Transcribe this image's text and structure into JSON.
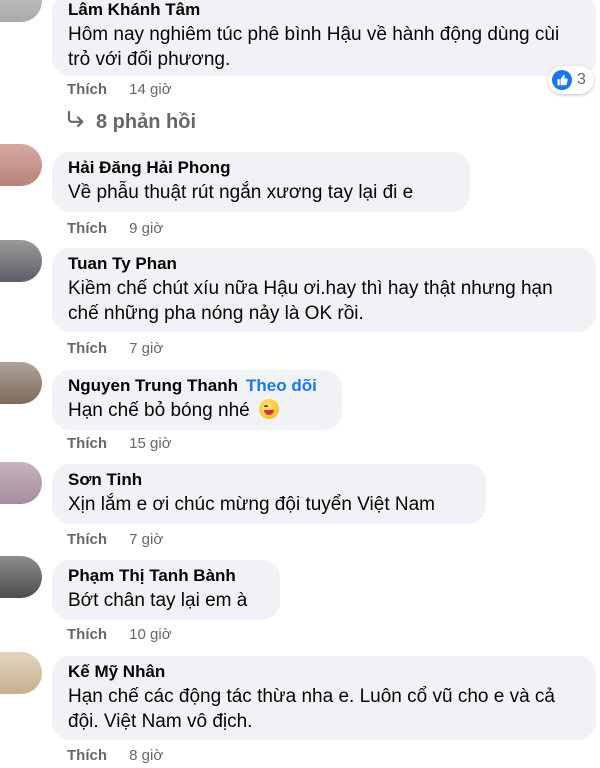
{
  "colors": {
    "bubble": "#f0f2f5",
    "link": "#1877f2",
    "muted": "#65676b",
    "text": "#050505"
  },
  "like_label": "Thích",
  "comments": [
    {
      "author": "Lâm Khánh Tâm",
      "text": "Hôm nay nghiêm túc phê bình Hậu về hành động dùng cùi trỏ với đối phương.",
      "time": "14 giờ",
      "reaction_icon": "like-icon",
      "reaction_count": "3"
    },
    {
      "author": "Hải Đăng Hải Phong",
      "text": "Về phẫu thuật rút ngắn xương tay lại đi e",
      "time": "9 giờ"
    },
    {
      "author": "Tuan Ty Phan",
      "text": "Kiềm chế chút xíu nữa Hậu ơi.hay thì hay thật nhưng hạn chế những pha nóng nảy là OK rồi.",
      "time": "7 giờ"
    },
    {
      "author": "Nguyen Trung Thanh",
      "follow": "Theo dõi",
      "text": "Hạn chế bỏ bóng nhé",
      "emoji": "winking-tongue-emoji",
      "time": "15 giờ"
    },
    {
      "author": "Sơn Tinh",
      "text": "Xịn lắm e ơi chúc mừng đội tuyển Việt Nam",
      "time": "7 giờ"
    },
    {
      "author": "Phạm Thị Tanh Bành",
      "text": "Bớt chân tay lại em à",
      "time": "10 giờ"
    },
    {
      "author": "Kế Mỹ Nhân",
      "text": "Hạn chế các động tác thừa nha e. Luôn cổ vũ cho e và cả đội. Việt Nam vô địch.",
      "time": "8 giờ"
    }
  ],
  "replies_link": {
    "icon": "reply-arrow-icon",
    "label": "8 phản hồi"
  }
}
